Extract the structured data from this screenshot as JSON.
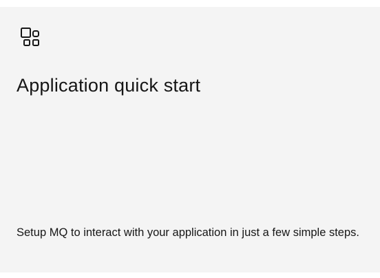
{
  "tile": {
    "icon": "application-icon",
    "title": "Application quick start",
    "description": "Setup MQ to interact with your application in just a few simple steps."
  }
}
